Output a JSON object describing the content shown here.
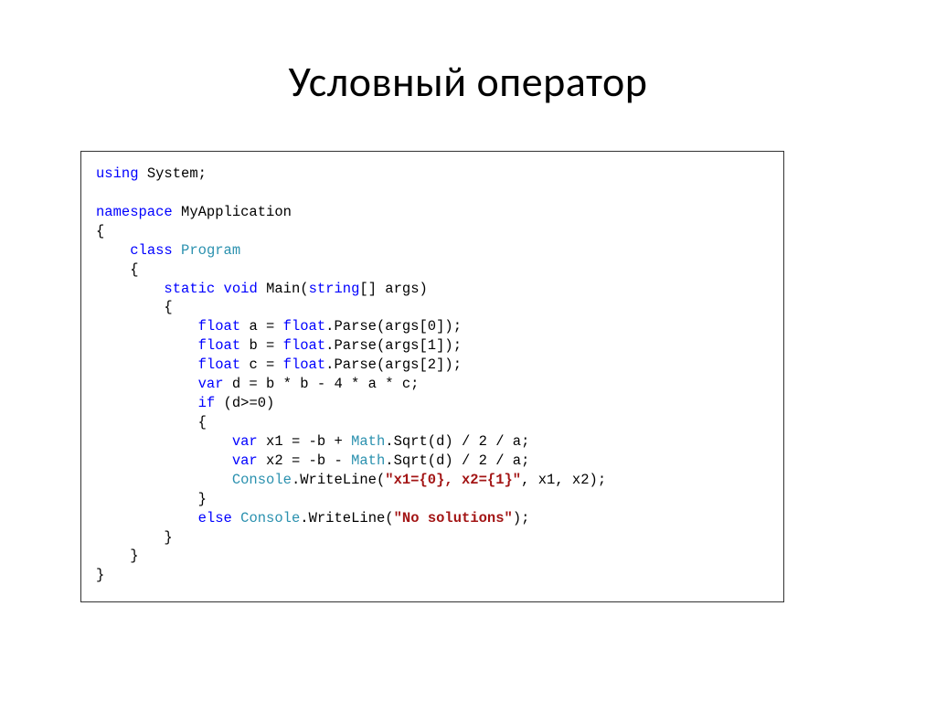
{
  "title": "Условный оператор",
  "code": {
    "l1_kw": "using",
    "l1_rest": " System;",
    "l2": "",
    "l3_kw": "namespace",
    "l3_rest": " MyApplication",
    "l4": "{",
    "l5_pre": "    ",
    "l5_kw": "class",
    "l5_sp": " ",
    "l5_type": "Program",
    "l6": "    {",
    "l7_pre": "        ",
    "l7_kw1": "static",
    "l7_sp1": " ",
    "l7_kw2": "void",
    "l7_mid": " Main(",
    "l7_kw3": "string",
    "l7_end": "[] args)",
    "l8": "        {",
    "l9_pre": "            ",
    "l9_kw1": "float",
    "l9_mid": " a = ",
    "l9_kw2": "float",
    "l9_end": ".Parse(args[0]);",
    "l10_pre": "            ",
    "l10_kw1": "float",
    "l10_mid": " b = ",
    "l10_kw2": "float",
    "l10_end": ".Parse(args[1]);",
    "l11_pre": "            ",
    "l11_kw1": "float",
    "l11_mid": " c = ",
    "l11_kw2": "float",
    "l11_end": ".Parse(args[2]);",
    "l12_pre": "            ",
    "l12_kw": "var",
    "l12_end": " d = b * b - 4 * a * c;",
    "l13_pre": "            ",
    "l13_kw": "if",
    "l13_end": " (d>=0)",
    "l14": "            {",
    "l15_pre": "                ",
    "l15_kw": "var",
    "l15_mid": " x1 = -b + ",
    "l15_type": "Math",
    "l15_end": ".Sqrt(d) / 2 / a;",
    "l16_pre": "                ",
    "l16_kw": "var",
    "l16_mid": " x2 = -b - ",
    "l16_type": "Math",
    "l16_end": ".Sqrt(d) / 2 / a;",
    "l17_pre": "                ",
    "l17_type": "Console",
    "l17_mid": ".WriteLine(",
    "l17_str": "\"x1={0}, x2={1}\"",
    "l17_end": ", x1, x2);",
    "l18": "            }",
    "l19_pre": "            ",
    "l19_kw": "else",
    "l19_sp": " ",
    "l19_type": "Console",
    "l19_mid": ".WriteLine(",
    "l19_str": "\"No solutions\"",
    "l19_end": ");",
    "l20": "        }",
    "l21": "    }",
    "l22": "}"
  }
}
